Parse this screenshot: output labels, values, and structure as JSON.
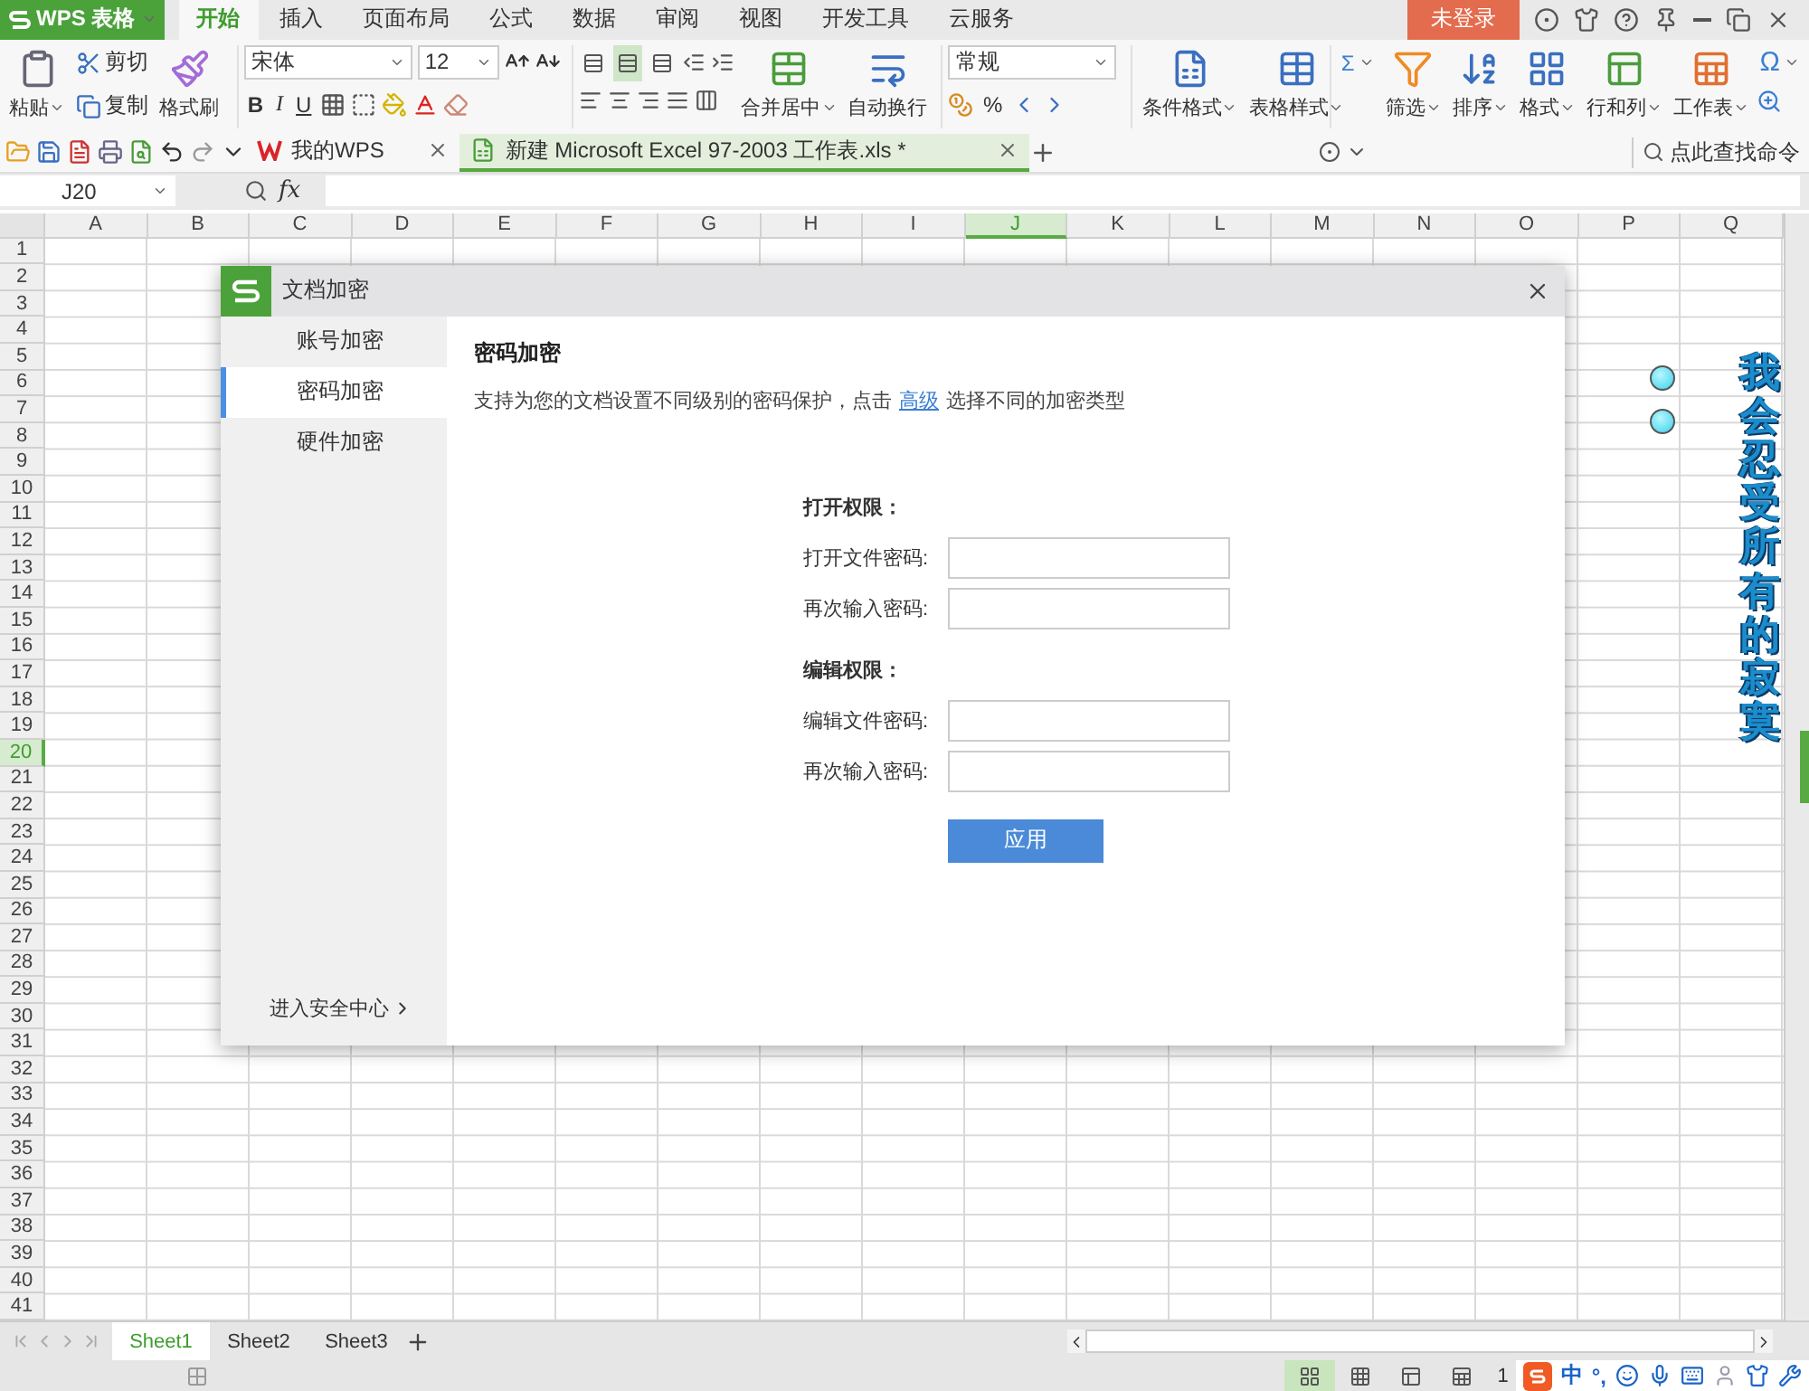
{
  "app_menu": {
    "label": "WPS 表格"
  },
  "tabs": [
    {
      "label": "开始",
      "selected": true
    },
    {
      "label": "插入",
      "selected": false
    },
    {
      "label": "页面布局",
      "selected": false
    },
    {
      "label": "公式",
      "selected": false
    },
    {
      "label": "数据",
      "selected": false
    },
    {
      "label": "审阅",
      "selected": false
    },
    {
      "label": "视图",
      "selected": false
    },
    {
      "label": "开发工具",
      "selected": false
    },
    {
      "label": "云服务",
      "selected": false
    }
  ],
  "login": "未登录",
  "ribbon": {
    "clipboard": {
      "paste": "粘贴",
      "cut": "剪切",
      "copy": "复制",
      "format_painter": "格式刷"
    },
    "font": {
      "name": "宋体",
      "size": "12",
      "bold": "B",
      "italic": "I",
      "underline": "U"
    },
    "alignment": {
      "buttons": [
        {
          "selected": false
        },
        {
          "selected": true
        },
        {
          "selected": false
        }
      ],
      "merge": "合并居中",
      "wrap": "自动换行"
    },
    "number": {
      "format": "常规",
      "percent": "%"
    },
    "styles": [
      "条件格式",
      "表格样式"
    ],
    "editing": {
      "sum": "Σ",
      "symbol": "Ω",
      "buttons": [
        "筛选",
        "排序",
        "格式",
        "行和列",
        "工作表"
      ]
    }
  },
  "doc_tabs": [
    {
      "label": "我的WPS",
      "selected": false
    },
    {
      "label": "新建 Microsoft Excel 97-2003 工作表.xls *",
      "selected": true
    }
  ],
  "command_search": "点此查找命令",
  "formula_bar": {
    "cell_ref": "J20",
    "fx": "fx"
  },
  "sheet": {
    "columns": [
      {
        "label": "A",
        "selected": false
      },
      {
        "label": "B",
        "selected": false
      },
      {
        "label": "C",
        "selected": false
      },
      {
        "label": "D",
        "selected": false
      },
      {
        "label": "E",
        "selected": false
      },
      {
        "label": "F",
        "selected": false
      },
      {
        "label": "G",
        "selected": false
      },
      {
        "label": "H",
        "selected": false
      },
      {
        "label": "I",
        "selected": false
      },
      {
        "label": "J",
        "selected": true
      },
      {
        "label": "K",
        "selected": false
      },
      {
        "label": "L",
        "selected": false
      },
      {
        "label": "M",
        "selected": false
      },
      {
        "label": "N",
        "selected": false
      },
      {
        "label": "O",
        "selected": false
      },
      {
        "label": "P",
        "selected": false
      },
      {
        "label": "Q",
        "selected": false
      }
    ],
    "rows": [
      {
        "label": "1",
        "selected": false
      },
      {
        "label": "2",
        "selected": false
      },
      {
        "label": "3",
        "selected": false
      },
      {
        "label": "4",
        "selected": false
      },
      {
        "label": "5",
        "selected": false
      },
      {
        "label": "6",
        "selected": false
      },
      {
        "label": "7",
        "selected": false
      },
      {
        "label": "8",
        "selected": false
      },
      {
        "label": "9",
        "selected": false
      },
      {
        "label": "10",
        "selected": false
      },
      {
        "label": "11",
        "selected": false
      },
      {
        "label": "12",
        "selected": false
      },
      {
        "label": "13",
        "selected": false
      },
      {
        "label": "14",
        "selected": false
      },
      {
        "label": "15",
        "selected": false
      },
      {
        "label": "16",
        "selected": false
      },
      {
        "label": "17",
        "selected": false
      },
      {
        "label": "18",
        "selected": false
      },
      {
        "label": "19",
        "selected": false
      },
      {
        "label": "20",
        "selected": true
      },
      {
        "label": "21",
        "selected": false
      },
      {
        "label": "22",
        "selected": false
      },
      {
        "label": "23",
        "selected": false
      },
      {
        "label": "24",
        "selected": false
      },
      {
        "label": "25",
        "selected": false
      },
      {
        "label": "26",
        "selected": false
      },
      {
        "label": "27",
        "selected": false
      },
      {
        "label": "28",
        "selected": false
      },
      {
        "label": "29",
        "selected": false
      },
      {
        "label": "30",
        "selected": false
      },
      {
        "label": "31",
        "selected": false
      },
      {
        "label": "32",
        "selected": false
      },
      {
        "label": "33",
        "selected": false
      },
      {
        "label": "34",
        "selected": false
      },
      {
        "label": "35",
        "selected": false
      },
      {
        "label": "36",
        "selected": false
      },
      {
        "label": "37",
        "selected": false
      },
      {
        "label": "38",
        "selected": false
      },
      {
        "label": "39",
        "selected": false
      },
      {
        "label": "40",
        "selected": false
      },
      {
        "label": "41",
        "selected": false
      }
    ],
    "wordart": "我会忍受所有的寂寞"
  },
  "dialog": {
    "title": "文档加密",
    "nav": [
      {
        "label": "账号加密",
        "selected": false
      },
      {
        "label": "密码加密",
        "selected": true
      },
      {
        "label": "硬件加密",
        "selected": false
      }
    ],
    "security_link": "进入安全中心",
    "heading": "密码加密",
    "description": "支持为您的文档设置不同级别的密码保护，点击",
    "link": "高级",
    "description_tail": "选择不同的加密类型",
    "sections": [
      {
        "title": "打开权限：",
        "fields": [
          {
            "label": "打开文件密码:"
          },
          {
            "label": "再次输入密码:"
          }
        ]
      },
      {
        "title": "编辑权限：",
        "fields": [
          {
            "label": "编辑文件密码:"
          },
          {
            "label": "再次输入密码:"
          }
        ]
      }
    ],
    "apply": "应用"
  },
  "sheet_tabs": [
    {
      "label": "Sheet1",
      "selected": true
    },
    {
      "label": "Sheet2",
      "selected": false
    },
    {
      "label": "Sheet3",
      "selected": false
    }
  ],
  "status": {
    "zoom": "1",
    "ime_mode": "中",
    "ime_punct": "°,"
  }
}
